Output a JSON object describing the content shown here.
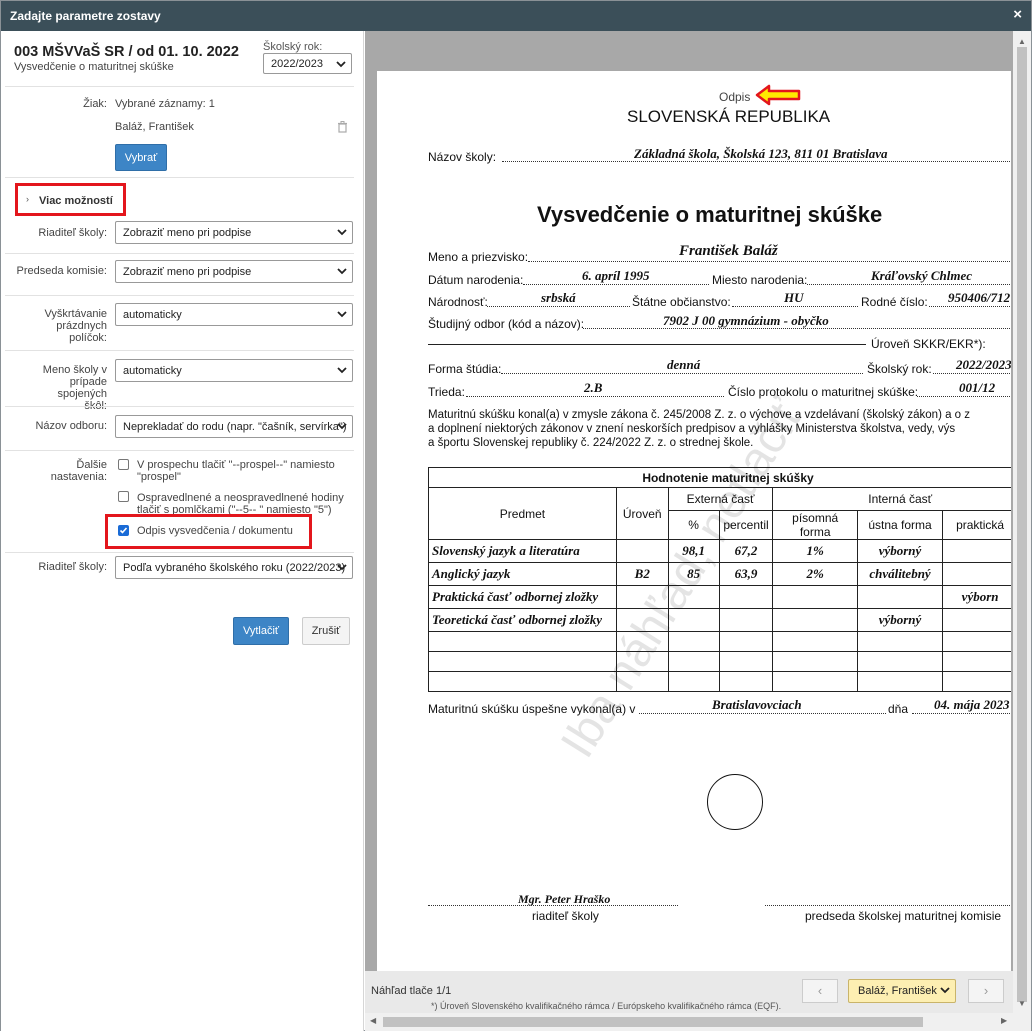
{
  "dialog": {
    "title": "Zadajte parametre zostavy",
    "close": "×"
  },
  "report": {
    "title": "003 MŠVVaŠ SR / od 01. 10. 2022",
    "subtitle": "Vysvedčenie o maturitnej skúške"
  },
  "school_year": {
    "label": "Školský rok:",
    "value": "2022/2023"
  },
  "form": {
    "student_label": "Žiak:",
    "student_count": "Vybrané záznamy: 1",
    "student_name": "Baláž, František",
    "select_button": "Vybrať",
    "more_options": "Viac možností",
    "director_label": "Riaditeľ školy:",
    "director_value": "Zobraziť meno pri podpise",
    "chair_label": "Predseda komisie:",
    "chair_value": "Zobraziť meno pri podpise",
    "blank_label": "Vyškrtávanie prázdnych políčok:",
    "blank_value": "automaticky",
    "schoolname_label": "Meno školy v prípade spojených škôl:",
    "schoolname_value": "automaticky",
    "field_label": "Názov odboru:",
    "field_value": "Neprekladať do rodu (napr. \"čašník, servírka\")",
    "other_label": "Ďalšie nastavenia:",
    "opt1": "V prospechu tlačiť \"--prospel--\" namiesto \"prospel\"",
    "opt2": "Ospravedlnené a neospravedlnené hodiny tlačiť s pomlčkami (\"--5-- \" namiesto \"5\")",
    "opt3": "Odpis vysvedčenia / dokumentu",
    "director2_label": "Riaditeľ školy:",
    "director2_value": "Podľa vybraného školského roku (2022/2023)",
    "print_button": "Vytlačiť",
    "cancel_button": "Zrušiť"
  },
  "preview": {
    "odpis": "Odpis",
    "republic": "SLOVENSKÁ REPUBLIKA",
    "school_label": "Názov školy:",
    "school_value": "Základná škola, Školská 123, 811 01  Bratislava",
    "doc_title": "Vysvedčenie o maturitnej skúške",
    "name_label": "Meno a priezvisko:",
    "name_value": "František Baláž",
    "birth_label": "Dátum narodenia:",
    "birth_value": "6. apríl 1995",
    "place_label": "Miesto narodenia:",
    "place_value": "Kráľovský Chlmec",
    "nation_label": "Národnosť:",
    "nation_value": "srbská",
    "citizen_label": "Štátne občianstvo:",
    "citizen_value": "HU",
    "id_label": "Rodné číslo:",
    "id_value": "950406/712",
    "field_label": "Študijný odbor (kód a názov):",
    "field_value": "7902 J 00 gymnázium - obyčko",
    "level_label": "Úroveň SKKR/EKR*):",
    "form_label": "Forma štúdia:",
    "form_value": "denná",
    "year_label": "Školský rok:",
    "year_value": "2022/2023",
    "class_label": "Trieda:",
    "class_value": "2.B",
    "protocol_label": "Číslo protokolu o maturitnej skúške:",
    "protocol_value": "001/12",
    "law_text_1": "Maturitnú skúšku konal(a) v zmysle zákona č. 245/2008 Z. z. o výchove a vzdelávaní (školský zákon) a o z",
    "law_text_2": "a doplnení niektorých zákonov v znení neskorších predpisov a vyhlášky Ministerstva školstva, vedy, výs",
    "law_text_3": "a športu Slovenskej republiky č. 224/2022 Z. z. o strednej škole.",
    "table_title": "Hodnotenie maturitnej skúšky",
    "col_subject": "Predmet",
    "col_level": "Úroveň",
    "col_external": "Externá časť",
    "col_internal": "Interná časť",
    "col_pct": "%",
    "col_percentile": "percentil",
    "col_written": "písomná forma",
    "col_oral": "ústna forma",
    "col_practical": "praktická",
    "rows": [
      {
        "subject": "Slovenský jazyk a literatúra",
        "level": "",
        "pct": "98,1",
        "percentile": "67,2",
        "written": "1%",
        "oral": "výborný",
        "practical": ""
      },
      {
        "subject": "Anglický jazyk",
        "level": "B2",
        "pct": "85",
        "percentile": "63,9",
        "written": "2%",
        "oral": "chválitebný",
        "practical": ""
      },
      {
        "subject": "Praktická časť odbornej zložky",
        "level": "",
        "pct": "",
        "percentile": "",
        "written": "",
        "oral": "",
        "practical": "výborn"
      },
      {
        "subject": "Teoretická časť odbornej zložky",
        "level": "",
        "pct": "",
        "percentile": "",
        "written": "",
        "oral": "výborný",
        "practical": ""
      }
    ],
    "passed_label": "Maturitnú skúšku úspešne vykonal(a) v",
    "passed_place": "Bratislavovciach",
    "day_label": "dňa",
    "day_value": "04. mája 2023",
    "signer_name": "Mgr.  Peter Hraško",
    "signer_role": "riaditeľ školy",
    "chair_role": "predseda školskej maturitnej komisie",
    "watermark": "Iba náhľad, netlačiť",
    "footnote": "*) Úroveň Slovenského kvalifikačného rámca / Európskeho kvalifikačného rámca (EQF).",
    "page_label": "Náhľad tlače 1/1",
    "student_select": "Baláž, František",
    "prev": "‹",
    "next": "›"
  },
  "colors": {
    "title_bar": "#3b4f59",
    "primary_button": "#3d85c6",
    "highlight": "#e3161c",
    "arrow": "#ffeb00"
  }
}
